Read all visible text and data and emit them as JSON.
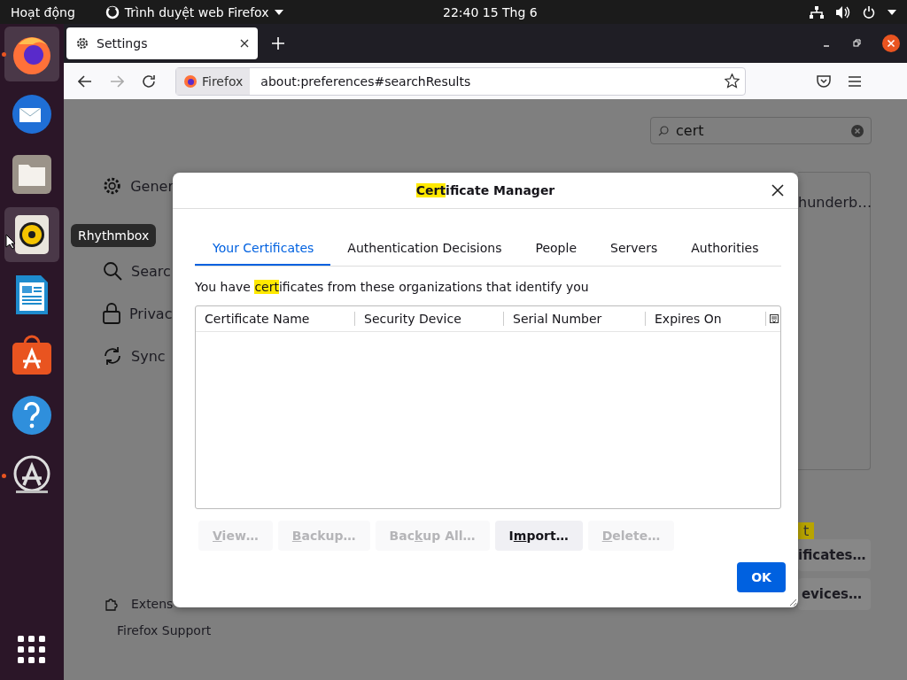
{
  "top_bar": {
    "activities": "Hoạt động",
    "app_menu": "Trình duyệt web Firefox",
    "clock": "22:40  15 Thg 6"
  },
  "dock": {
    "items": [
      {
        "kind": "firefox",
        "running": true,
        "highlighted": true
      },
      {
        "kind": "mail",
        "running": false,
        "highlighted": false
      },
      {
        "kind": "files",
        "running": false,
        "highlighted": false
      },
      {
        "kind": "speaker",
        "running": false,
        "highlighted": true
      },
      {
        "kind": "writer",
        "running": false,
        "highlighted": false
      },
      {
        "kind": "store",
        "running": false,
        "highlighted": false
      },
      {
        "kind": "help",
        "running": false,
        "highlighted": false
      },
      {
        "kind": "updater",
        "running": true,
        "highlighted": false
      }
    ],
    "tooltip": "Rhythmbox"
  },
  "browser": {
    "tab": {
      "title": "Settings"
    },
    "url_bar": {
      "identity": "Firefox",
      "url": "about:preferences#searchResults"
    }
  },
  "settings": {
    "search": {
      "value": "cert"
    },
    "sidebar": [
      {
        "kind": "gear",
        "label": "Gener"
      },
      {
        "kind": "search",
        "label": "Searc"
      },
      {
        "kind": "lock",
        "label": "Privac"
      },
      {
        "kind": "sync",
        "label": "Sync"
      }
    ],
    "footer": [
      {
        "kind": "puzzle",
        "label": "Extens"
      },
      {
        "kind": "help",
        "label": "Firefox Support"
      }
    ],
    "right": {
      "fragment": "hunderb…",
      "highlight": "t",
      "buttons": [
        "ificates…",
        "evices…"
      ]
    }
  },
  "dialog": {
    "title": [
      {
        "text": "Cert",
        "highlighted": true
      },
      {
        "text": "ificate Manager",
        "highlighted": false
      }
    ],
    "tabs": [
      {
        "label": "Your Certificates",
        "selected": true
      },
      {
        "label": "Authentication Decisions",
        "selected": false
      },
      {
        "label": "People",
        "selected": false
      },
      {
        "label": "Servers",
        "selected": false
      },
      {
        "label": "Authorities",
        "selected": false
      }
    ],
    "description": [
      {
        "text": "You have ",
        "highlighted": false
      },
      {
        "text": "cert",
        "highlighted": true
      },
      {
        "text": "ificates from these organizations that identify you",
        "highlighted": false
      }
    ],
    "columns": [
      "Certificate Name",
      "Security Device",
      "Serial Number",
      "Expires On"
    ],
    "buttons": [
      {
        "key": "V",
        "post": "iew…",
        "disabled": true
      },
      {
        "key": "B",
        "post": "ackup…",
        "disabled": true
      },
      {
        "pre": "Bac",
        "key": "k",
        "post": "up All…",
        "disabled": true
      },
      {
        "pre": "I",
        "key": "m",
        "post": "port…",
        "disabled": false
      },
      {
        "key": "D",
        "post": "elete…",
        "disabled": true
      }
    ],
    "ok": "OK"
  }
}
